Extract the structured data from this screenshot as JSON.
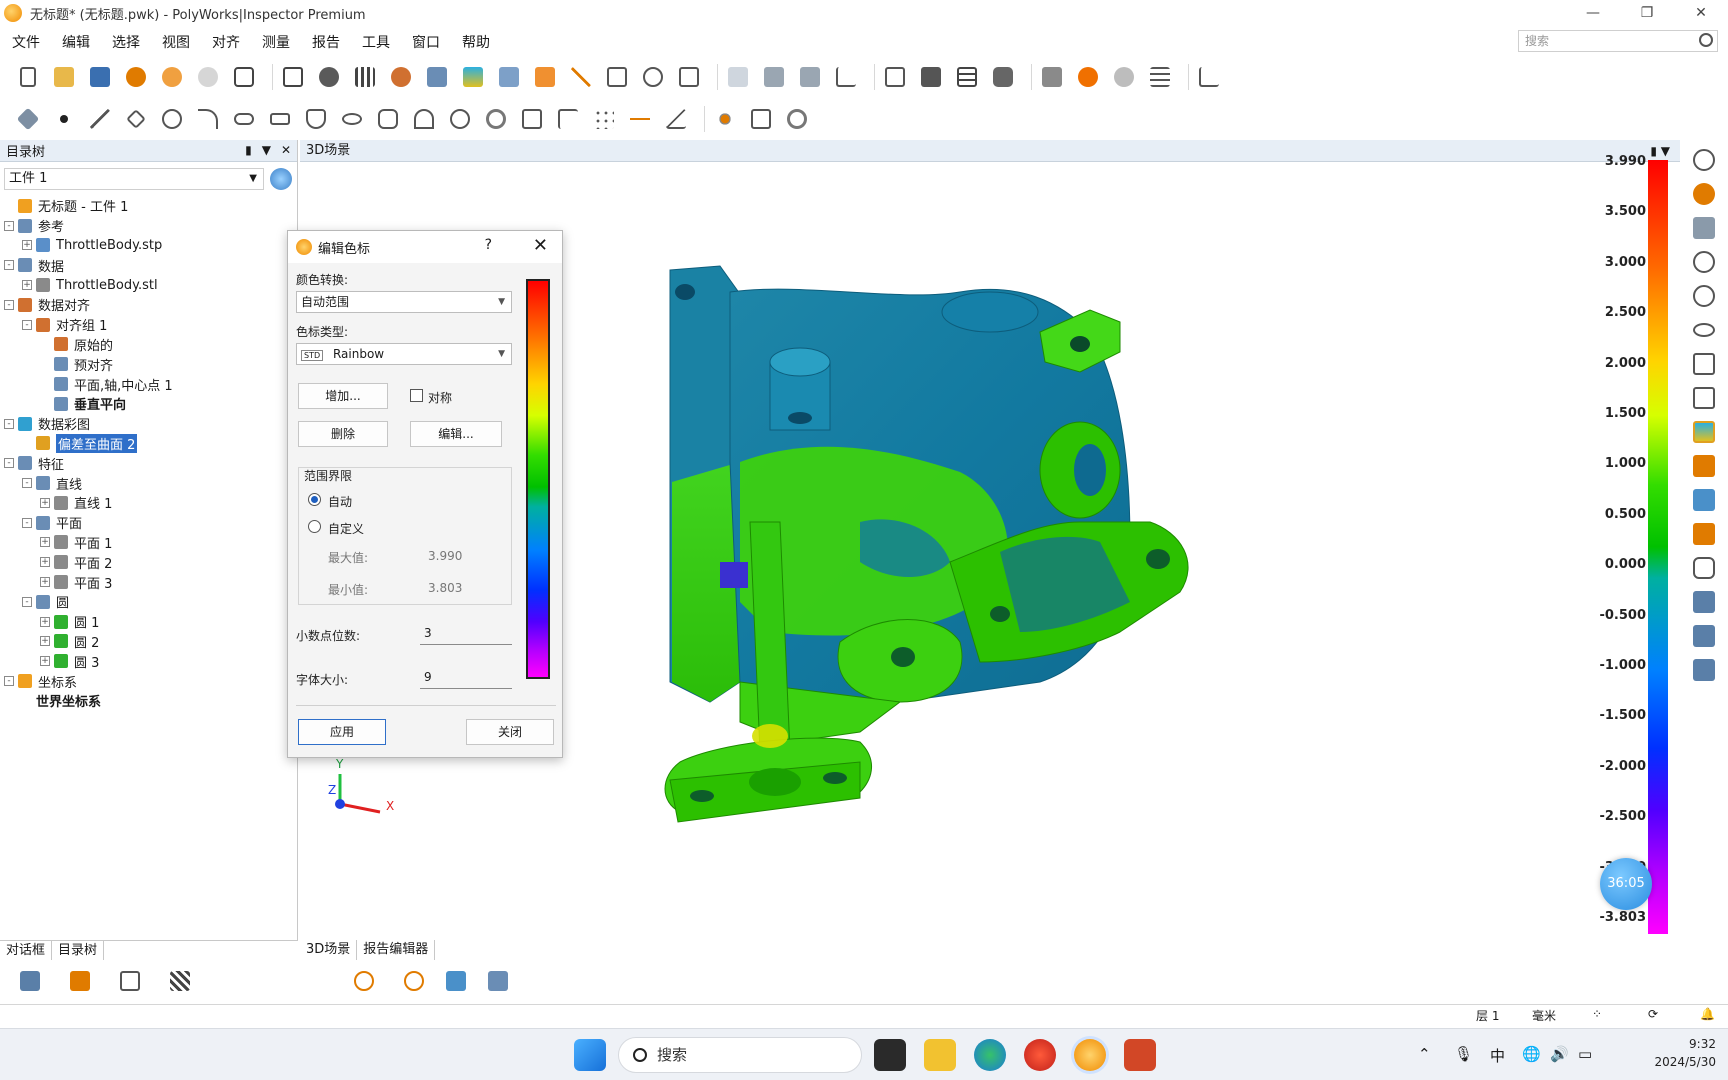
{
  "window": {
    "title": "无标题* (无标题.pwk) - PolyWorks|Inspector Premium",
    "controls": [
      "—",
      "❐",
      "✕"
    ]
  },
  "menu": {
    "items": [
      "文件",
      "编辑",
      "选择",
      "视图",
      "对齐",
      "测量",
      "报告",
      "工具",
      "窗口",
      "帮助"
    ],
    "search_placeholder": "搜索"
  },
  "left_panel": {
    "header": "目录树",
    "workpiece_select": "工件 1",
    "tree": [
      {
        "label": "无标题 - 工件 1",
        "level": 0,
        "icon": "project-icon",
        "color": "#f0a020"
      },
      {
        "label": "参考",
        "level": 0,
        "icon": "reference-icon",
        "color": "#6a8db5",
        "exp": "-"
      },
      {
        "label": "ThrottleBody.stp",
        "level": 1,
        "icon": "cad-icon",
        "color": "#5a8fc9",
        "exp": "+"
      },
      {
        "label": "数据",
        "level": 0,
        "icon": "data-icon",
        "color": "#6a8db5",
        "exp": "-"
      },
      {
        "label": "ThrottleBody.stl",
        "level": 1,
        "icon": "mesh-icon",
        "color": "#8a8a8a",
        "exp": "+"
      },
      {
        "label": "数据对齐",
        "level": 0,
        "icon": "alignment-icon",
        "color": "#d07030",
        "exp": "-"
      },
      {
        "label": "对齐组 1",
        "level": 1,
        "icon": "alignment-group-icon",
        "color": "#d07030",
        "exp": "-"
      },
      {
        "label": "原始的",
        "level": 2,
        "icon": "original-icon",
        "color": "#d07030"
      },
      {
        "label": "预对齐",
        "level": 2,
        "icon": "prealign-icon",
        "color": "#6a8db5"
      },
      {
        "label": "平面,轴,中心点 1",
        "level": 2,
        "icon": "plane-axis-icon",
        "color": "#6a8db5"
      },
      {
        "label": "垂直平向",
        "level": 2,
        "icon": "perpendicular-icon",
        "color": "#6a8db5",
        "bold": true
      },
      {
        "label": "数据彩图",
        "level": 0,
        "icon": "colormap-icon",
        "color": "#30a0d0",
        "exp": "-"
      },
      {
        "label": "偏差至曲面 2",
        "level": 1,
        "icon": "deviation-icon",
        "color": "#e0a020",
        "selected": true
      },
      {
        "label": "特征",
        "level": 0,
        "icon": "feature-icon",
        "color": "#6a8db5",
        "exp": "-"
      },
      {
        "label": "直线",
        "level": 1,
        "icon": "line-group-icon",
        "color": "#6a8db5",
        "exp": "-"
      },
      {
        "label": "直线 1",
        "level": 2,
        "icon": "line-icon",
        "color": "#8a8a8a",
        "exp": "+"
      },
      {
        "label": "平面",
        "level": 1,
        "icon": "plane-group-icon",
        "color": "#6a8db5",
        "exp": "-"
      },
      {
        "label": "平面 1",
        "level": 2,
        "icon": "plane-icon",
        "color": "#8a8a8a",
        "exp": "+"
      },
      {
        "label": "平面 2",
        "level": 2,
        "icon": "plane-icon",
        "color": "#8a8a8a",
        "exp": "+"
      },
      {
        "label": "平面 3",
        "level": 2,
        "icon": "plane-icon",
        "color": "#8a8a8a",
        "exp": "+"
      },
      {
        "label": "圆",
        "level": 1,
        "icon": "circle-group-icon",
        "color": "#6a8db5",
        "exp": "-"
      },
      {
        "label": "圆 1",
        "level": 2,
        "icon": "circle-icon",
        "color": "#30b030",
        "exp": "+"
      },
      {
        "label": "圆 2",
        "level": 2,
        "icon": "circle-icon",
        "color": "#30b030",
        "exp": "+"
      },
      {
        "label": "圆 3",
        "level": 2,
        "icon": "circle-icon",
        "color": "#30b030",
        "exp": "+"
      },
      {
        "label": "坐标系",
        "level": 0,
        "icon": "coordinate-system-icon",
        "color": "#f0a020",
        "exp": "-"
      },
      {
        "label": "世界坐标系",
        "level": 1,
        "icon": "",
        "color": "",
        "bold": true
      }
    ],
    "bottom_tabs": [
      "对话框",
      "目录树"
    ]
  },
  "scene": {
    "header": "3D场景",
    "tabs": [
      "3D场景",
      "报告编辑器"
    ],
    "axes": {
      "x": "X",
      "y": "Y",
      "z": "Z"
    }
  },
  "color_scale": {
    "labels": [
      "3.990",
      "3.500",
      "3.000",
      "2.500",
      "2.000",
      "1.500",
      "1.000",
      "0.500",
      "0.000",
      "-0.500",
      "-1.000",
      "-1.500",
      "-2.000",
      "-2.500",
      "-3.000",
      "-3.803"
    ]
  },
  "dialog": {
    "title": "编辑色标",
    "help": "?",
    "close_icon": "✕",
    "color_transform_label": "颜色转换:",
    "color_transform_value": "自动范围",
    "scale_type_label": "色标类型:",
    "scale_type_value": "Rainbow",
    "scale_type_badge": "STD",
    "add_button": "增加...",
    "symmetric_label": "对称",
    "delete_button": "删除",
    "edit_button": "编辑...",
    "range_group_label": "范围界限",
    "auto_label": "自动",
    "custom_label": "自定义",
    "max_label": "最大值:",
    "max_value": "3.990",
    "min_label": "最小值:",
    "min_value": "3.803",
    "decimals_label": "小数点位数:",
    "decimals_value": "3",
    "font_size_label": "字体大小:",
    "font_size_value": "9",
    "apply_button": "应用",
    "close_button": "关闭"
  },
  "statusbar": {
    "layer": "层 1",
    "unit": "毫米"
  },
  "timer": "36:05",
  "taskbar": {
    "search": "搜索",
    "ime": "中",
    "time": "9:32",
    "date": "2024/5/30"
  }
}
